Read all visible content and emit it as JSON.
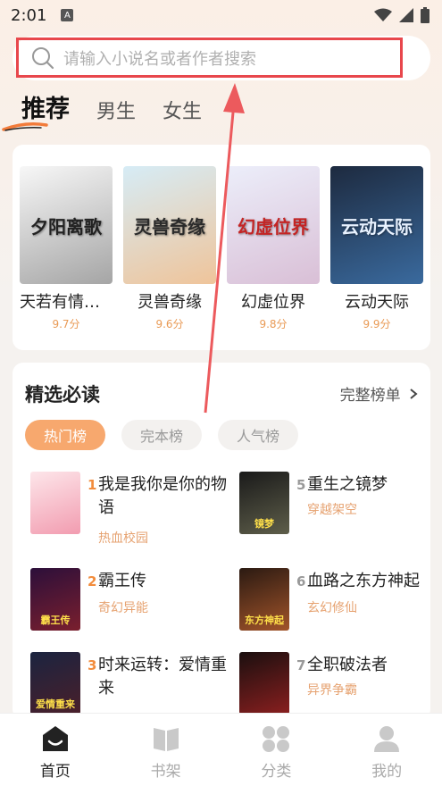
{
  "status": {
    "time": "2:01",
    "notif": "A"
  },
  "search": {
    "placeholder": "请输入小说名或者作者搜索"
  },
  "tabs": [
    {
      "label": "推荐",
      "active": true
    },
    {
      "label": "男生",
      "active": false
    },
    {
      "label": "女生",
      "active": false
    }
  ],
  "recommend": [
    {
      "title": "天若有情：...",
      "score": "9.7分",
      "cover_text": "夕阳离歌",
      "colors": [
        "#f2f2f2",
        "#9a9a9a"
      ],
      "text_color": "#222"
    },
    {
      "title": "灵兽奇缘",
      "score": "9.6分",
      "cover_text": "灵兽奇缘",
      "colors": [
        "#cfe7f3",
        "#f0c7a0"
      ],
      "text_color": "#2a2a2a"
    },
    {
      "title": "幻虚位界",
      "score": "9.8分",
      "cover_text": "幻虚位界",
      "colors": [
        "#e8e9f8",
        "#d7c2d8"
      ],
      "text_color": "#c42424"
    },
    {
      "title": "云动天际",
      "score": "9.9分",
      "cover_text": "云动天际",
      "colors": [
        "#1d2a3f",
        "#2f5a8a"
      ],
      "text_color": "#e8f2ff"
    }
  ],
  "picks": {
    "title": "精选必读",
    "more": "完整榜单",
    "chips": [
      {
        "label": "热门榜",
        "active": true
      },
      {
        "label": "完本榜",
        "active": false
      },
      {
        "label": "人气榜",
        "active": false
      }
    ],
    "left": [
      {
        "rank": "1",
        "title": "我是我你是你的物语",
        "tag": "热血校园",
        "cover_colors": [
          "#fde2e7",
          "#f5a9b8"
        ],
        "cover_text": ""
      },
      {
        "rank": "2",
        "title": "霸王传",
        "tag": "奇幻异能",
        "cover_colors": [
          "#2c0f3a",
          "#7a1f2e"
        ],
        "cover_text": "霸王传"
      },
      {
        "rank": "3",
        "title": "时来运转：爱情重来",
        "tag": "",
        "cover_colors": [
          "#1b2440",
          "#4a1f2a"
        ],
        "cover_text": "爱情重来"
      }
    ],
    "right": [
      {
        "rank": "5",
        "title": "重生之镜梦",
        "tag": "穿越架空",
        "cover_colors": [
          "#1a1a1a",
          "#5e5e4a"
        ],
        "cover_text": "镜梦"
      },
      {
        "rank": "6",
        "title": "血路之东方神起",
        "tag": "玄幻修仙",
        "cover_colors": [
          "#2b1a12",
          "#a2542a"
        ],
        "cover_text": "东方神起"
      },
      {
        "rank": "7",
        "title": "全职破法者",
        "tag": "异界争霸",
        "cover_colors": [
          "#1a0f0f",
          "#8a1f1f"
        ],
        "cover_text": ""
      }
    ]
  },
  "nav": [
    {
      "label": "首页",
      "icon": "home-icon",
      "active": true
    },
    {
      "label": "书架",
      "icon": "bookshelf-icon",
      "active": false
    },
    {
      "label": "分类",
      "icon": "category-icon",
      "active": false
    },
    {
      "label": "我的",
      "icon": "profile-icon",
      "active": false
    }
  ]
}
